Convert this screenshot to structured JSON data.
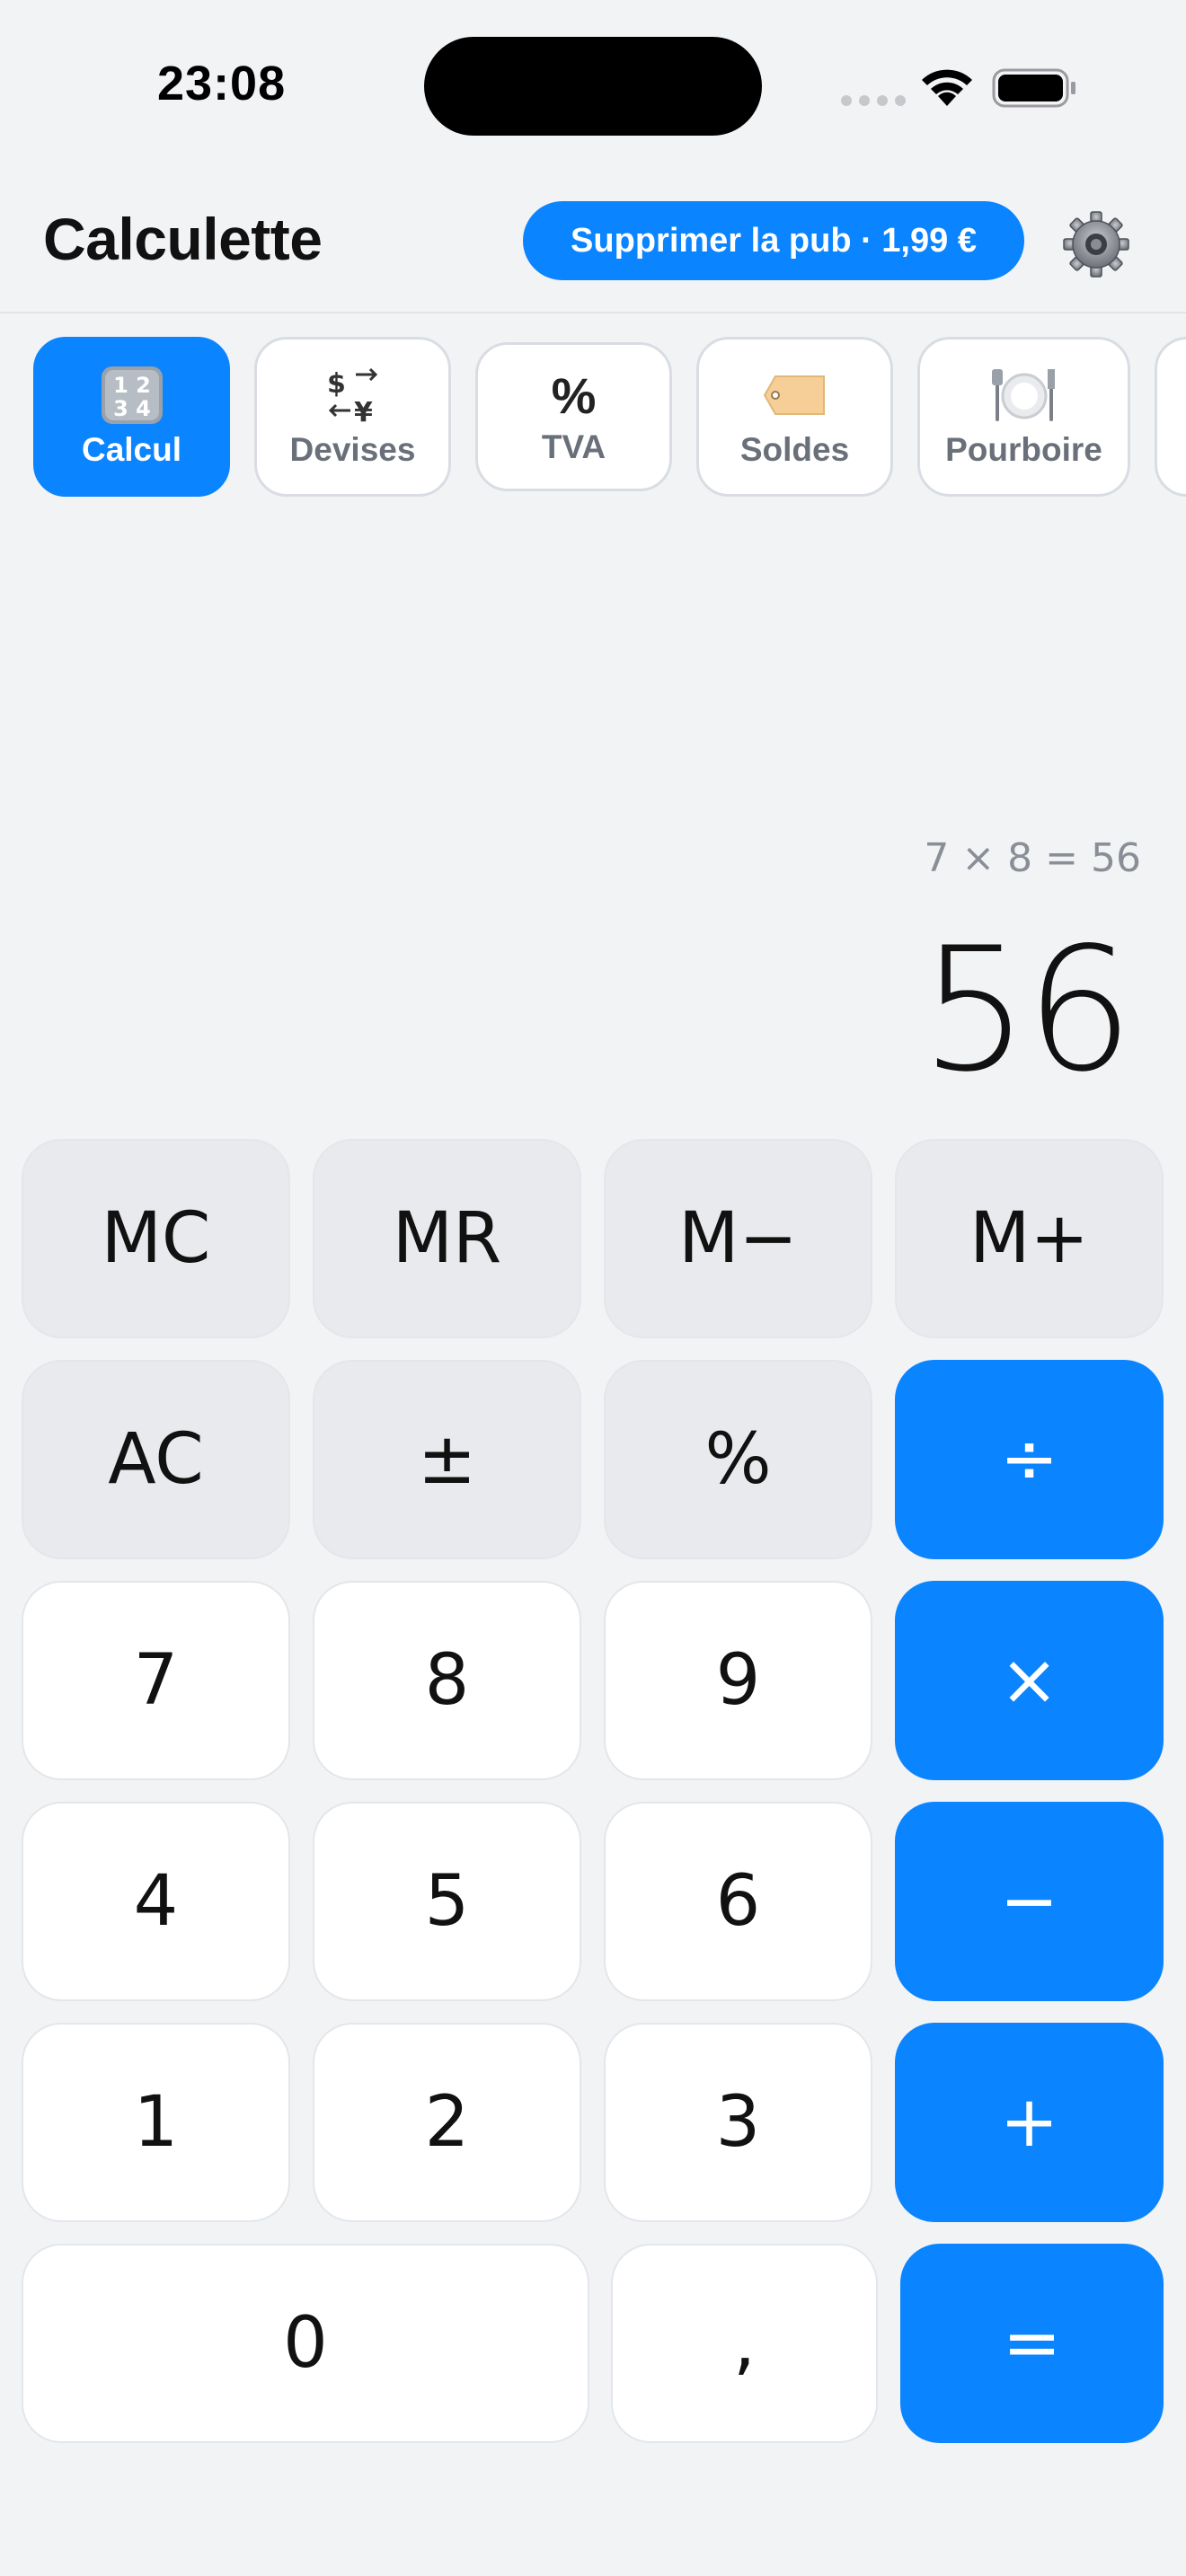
{
  "status_bar": {
    "time": "23:08"
  },
  "header": {
    "title": "Calculette",
    "remove_ads_label": "Supprimer la pub · 1,99 €"
  },
  "tabs": [
    {
      "label": "Calcul",
      "icon": "1234-icon",
      "glyph": "🔢",
      "active": true
    },
    {
      "label": "Devises",
      "icon": "currency-exchange-icon",
      "glyph": "💱",
      "active": false
    },
    {
      "label": "TVA",
      "icon": "percent-icon",
      "glyph": "%",
      "active": false
    },
    {
      "label": "Soldes",
      "icon": "price-tag-icon",
      "glyph": "🏷",
      "active": false
    },
    {
      "label": "Pourboire",
      "icon": "plate-cutlery-icon",
      "glyph": "🍽",
      "active": false
    }
  ],
  "display": {
    "expression": "7 × 8 = 56",
    "result": "56"
  },
  "keypad": {
    "memory": [
      "MC",
      "MR",
      "M−",
      "M+"
    ],
    "row2": [
      "AC",
      "±",
      "%",
      "÷"
    ],
    "row3": [
      "7",
      "8",
      "9",
      "×"
    ],
    "row4": [
      "4",
      "5",
      "6",
      "−"
    ],
    "row5": [
      "1",
      "2",
      "3",
      "+"
    ],
    "row6": [
      "0",
      ",",
      "="
    ]
  },
  "colors": {
    "accent": "#0a84ff",
    "background": "#f2f3f5",
    "function_key": "#e8eaed",
    "digit_key": "#ffffff"
  }
}
